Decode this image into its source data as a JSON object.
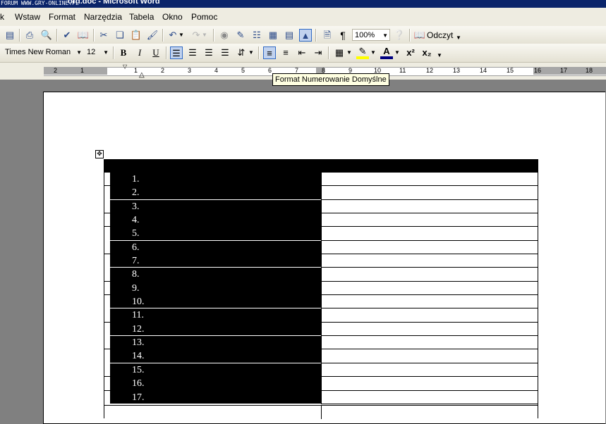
{
  "window": {
    "watermark": "FORUM WWW.GRY-ONLINE.PL",
    "title": "ord.doc - Microsoft Word"
  },
  "menu": [
    "k",
    "Wstaw",
    "Format",
    "Narzędzia",
    "Tabela",
    "Okno",
    "Pomoc"
  ],
  "standard_toolbar": {
    "zoom": "100%",
    "read_label": "Odczyt"
  },
  "format_toolbar": {
    "font": "Times New Roman",
    "size": "12"
  },
  "ruler": {
    "numbers": [
      "2",
      "1",
      "1",
      "2",
      "3",
      "4",
      "5",
      "6",
      "7",
      "8",
      "9",
      "10",
      "11",
      "12",
      "13",
      "14",
      "15",
      "16",
      "17",
      "18"
    ]
  },
  "tooltip": "Format Numerowanie Domyślne",
  "document": {
    "numbers": [
      "1.",
      "2.",
      "3.",
      "4.",
      "5.",
      "6.",
      "7.",
      "8.",
      "9.",
      "10.",
      "11.",
      "12.",
      "13.",
      "14.",
      "15.",
      "16.",
      "17."
    ]
  },
  "colors": {
    "title_bar": "#0a246a",
    "toolbar": "#eeece1",
    "selection": "#000000",
    "page": "#ffffff"
  }
}
